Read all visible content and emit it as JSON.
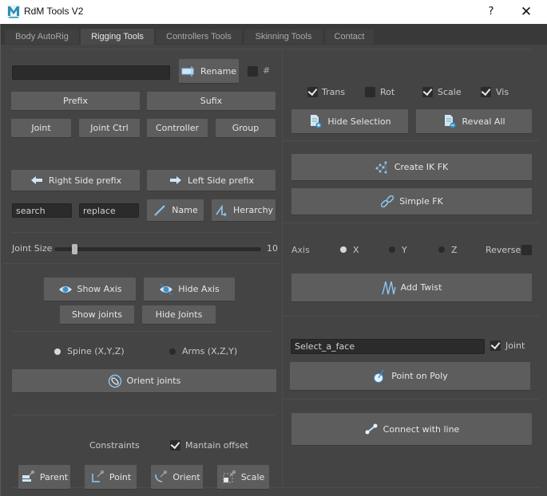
{
  "window": {
    "title": "RdM Tools V2",
    "help_label": "?",
    "close_label": "✕",
    "app_icon": "maya-logo-icon"
  },
  "tabs": [
    {
      "label": "Body AutoRig",
      "active": false
    },
    {
      "label": "Rigging Tools",
      "active": true
    },
    {
      "label": "Controllers Tools",
      "active": false
    },
    {
      "label": "Skinning Tools",
      "active": false
    },
    {
      "label": "Contact",
      "active": false
    }
  ],
  "left": {
    "rename": {
      "input_value": "",
      "button_label": "Rename",
      "button_icon": "rename-icon",
      "hash_checked": false,
      "hash_label": "#"
    },
    "prefix_label": "Prefix",
    "sufix_label": "Sufix",
    "type_buttons": [
      "Joint",
      "Joint Ctrl",
      "Controller",
      "Group"
    ],
    "right_side_prefix": {
      "label": "Right Side prefix",
      "icon": "arrow-left-icon"
    },
    "left_side_prefix": {
      "label": "Left Side prefix",
      "icon": "arrow-right-icon"
    },
    "search_value": "search",
    "replace_value": "replace",
    "name_button": {
      "label": "Name",
      "icon": "slash-icon"
    },
    "hierarchy_button": {
      "label": "Herarchy",
      "icon": "hierarchy-icon"
    },
    "joint_size": {
      "label": "Joint Size",
      "value": "10",
      "fraction": 0.05
    },
    "show_axis": {
      "label": "Show Axis",
      "icon": "eye-icon"
    },
    "hide_axis": {
      "label": "Hide Axis",
      "icon": "eye-off-icon"
    },
    "show_joints_label": "Show joints",
    "hide_joints_label": "Hide Joints",
    "orient_options": [
      {
        "label": "Spine (X,Y,Z)",
        "selected": true
      },
      {
        "label": "Arms (X,Z,Y)",
        "selected": false
      }
    ],
    "orient_joints": {
      "label": "Orient joints",
      "icon": "orient-joint-icon"
    },
    "constraints_label": "Constraints",
    "maintain_offset": {
      "label": "Mantain offset",
      "checked": true
    },
    "constraint_buttons": [
      {
        "label": "Parent",
        "icon": "parent-constraint-icon"
      },
      {
        "label": "Point",
        "icon": "point-constraint-icon"
      },
      {
        "label": "Orient",
        "icon": "orient-constraint-icon"
      },
      {
        "label": "Scale",
        "icon": "scale-constraint-icon"
      }
    ]
  },
  "right": {
    "channel_checks": [
      {
        "label": "Trans",
        "checked": true
      },
      {
        "label": "Rot",
        "checked": false
      },
      {
        "label": "Scale",
        "checked": true
      },
      {
        "label": "Vis",
        "checked": true
      }
    ],
    "hide_selection": {
      "label": "Hide Selection",
      "icon": "document-add-icon"
    },
    "reveal_all": {
      "label": "Reveal All",
      "icon": "document-remove-icon"
    },
    "create_ik_fk": {
      "label": "Create IK FK",
      "icon": "ik-fk-icon"
    },
    "simple_fk": {
      "label": "Simple FK",
      "icon": "chain-link-icon"
    },
    "axis": {
      "label": "Axis",
      "options": [
        {
          "label": "X",
          "selected": true
        },
        {
          "label": "Y",
          "selected": false
        },
        {
          "label": "Z",
          "selected": false
        }
      ],
      "reverse_label": "Reverse",
      "reverse_checked": false
    },
    "add_twist": {
      "label": "Add Twist",
      "icon": "twist-icon"
    },
    "face_field_value": "Select_a_face",
    "joint_check": {
      "label": "Joint",
      "checked": true
    },
    "point_on_poly": {
      "label": "Point on Poly",
      "icon": "point-on-poly-icon"
    },
    "connect_with_line": {
      "label": "Connect with line",
      "icon": "connect-line-icon"
    }
  },
  "colors": {
    "background": "#444444",
    "button": "#5d5d5d",
    "field": "#2b2b2b",
    "icon_accent": "#8fc6ee"
  }
}
